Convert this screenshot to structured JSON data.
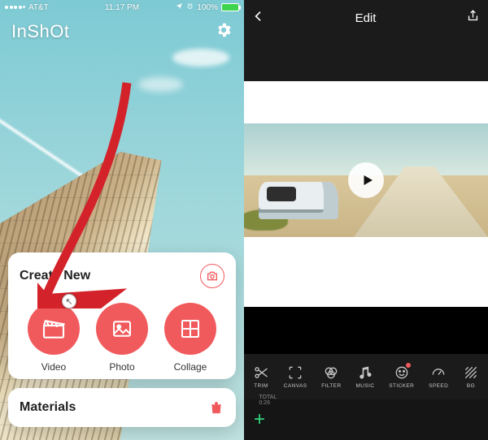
{
  "left": {
    "status": {
      "carrier": "AT&T",
      "time": "11:17 PM",
      "location_on": true,
      "battery_percent": "100%"
    },
    "app_name": "InShOt",
    "settings_icon": "gear-icon",
    "create": {
      "title": "Create New",
      "camera_icon": "camera-icon",
      "items": [
        {
          "key": "video",
          "label": "Video",
          "icon": "clapper-icon"
        },
        {
          "key": "photo",
          "label": "Photo",
          "icon": "image-icon"
        },
        {
          "key": "collage",
          "label": "Collage",
          "icon": "grid-icon"
        }
      ]
    },
    "materials": {
      "title": "Materials",
      "icon": "bag-icon"
    },
    "annotation_target": "video"
  },
  "right": {
    "header": {
      "back_icon": "chevron-left-icon",
      "title": "Edit",
      "share_icon": "share-icon"
    },
    "play_icon": "play-icon",
    "tools": [
      {
        "key": "trim",
        "label": "TRIM",
        "icon": "scissors-icon"
      },
      {
        "key": "canvas",
        "label": "CANVAS",
        "icon": "canvas-icon"
      },
      {
        "key": "filter",
        "label": "FILTER",
        "icon": "filter-icon"
      },
      {
        "key": "music",
        "label": "MUSIC",
        "icon": "music-icon"
      },
      {
        "key": "sticker",
        "label": "STICKER",
        "icon": "sticker-icon",
        "badge": true
      },
      {
        "key": "speed",
        "label": "SPEED",
        "icon": "speed-icon"
      },
      {
        "key": "bg",
        "label": "BG",
        "icon": "bg-icon"
      }
    ],
    "timeline": {
      "add_label": "+",
      "total_label": "TOTAL 0:26"
    }
  }
}
